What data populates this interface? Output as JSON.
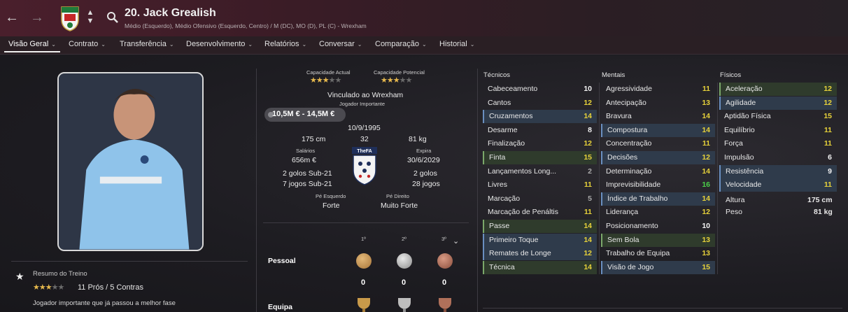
{
  "header": {
    "player_name": "20. Jack Grealish",
    "player_positions": "Médio (Esquerdo), Médio Ofensivo (Esquerdo, Centro) / M (DC), MO (D), PL (C) - Wrexham",
    "back_icon": "arrow-left-icon",
    "forward_icon": "arrow-right-icon",
    "search_icon": "search-icon"
  },
  "tabs": [
    {
      "label": "Visão Geral"
    },
    {
      "label": "Contrato"
    },
    {
      "label": "Transferência"
    },
    {
      "label": "Desenvolvimento"
    },
    {
      "label": "Relatórios"
    },
    {
      "label": "Conversar"
    },
    {
      "label": "Comparação"
    },
    {
      "label": "Historial"
    }
  ],
  "training": {
    "title": "Resumo do Treino",
    "pros_cons": "11 Prós / 5 Contras",
    "note": "Jogador importante que já passou a melhor fase",
    "stars": 3.5
  },
  "profile": {
    "current_ability_label": "Capacidade Actual",
    "potential_ability_label": "Capacidade Potencial",
    "current_ability_stars": 3.5,
    "potential_ability_stars": 3.5,
    "contract_club": "Vinculado ao Wrexham",
    "squad_status": "Jogador Importante",
    "value_range": "10,5M € - 14,5M €",
    "dob": "10/9/1995",
    "height": "175 cm",
    "age": "32",
    "weight": "81 kg",
    "wage_label": "Salários",
    "wage": "656m €",
    "expires_label": "Expira",
    "expires": "30/6/2029",
    "u21_goals": "2 golos Sub-21",
    "u21_caps": "7 jogos Sub-21",
    "intl_goals": "2 golos",
    "intl_caps": "28 jogos",
    "fa_label": "TheFA",
    "left_foot_label": "Pé Esquerdo",
    "left_foot": "Forte",
    "right_foot_label": "Pé Direito",
    "right_foot": "Muito Forte"
  },
  "awards": {
    "places": [
      "1º",
      "2º",
      "3º"
    ],
    "personal_label": "Pessoal",
    "team_label": "Equipa",
    "personal_counts": [
      "0",
      "0",
      "0"
    ]
  },
  "attributes": {
    "technical_title": "Técnicos",
    "mental_title": "Mentais",
    "physical_title": "Físicos",
    "technical": [
      {
        "name": "Cabeceamento",
        "value": "10",
        "hl": "",
        "color": "white"
      },
      {
        "name": "Cantos",
        "value": "12",
        "hl": "",
        "color": "yellow"
      },
      {
        "name": "Cruzamentos",
        "value": "14",
        "hl": "blue",
        "color": "yellow"
      },
      {
        "name": "Desarme",
        "value": "8",
        "hl": "",
        "color": "white"
      },
      {
        "name": "Finalização",
        "value": "12",
        "hl": "",
        "color": "yellow"
      },
      {
        "name": "Finta",
        "value": "15",
        "hl": "green",
        "color": "yellow"
      },
      {
        "name": "Lançamentos Long...",
        "value": "2",
        "hl": "",
        "color": "grey"
      },
      {
        "name": "Livres",
        "value": "11",
        "hl": "",
        "color": "yellow"
      },
      {
        "name": "Marcação",
        "value": "5",
        "hl": "",
        "color": "grey"
      },
      {
        "name": "Marcação de Penáltis",
        "value": "11",
        "hl": "",
        "color": "yellow"
      },
      {
        "name": "Passe",
        "value": "14",
        "hl": "green",
        "color": "yellow"
      },
      {
        "name": "Primeiro Toque",
        "value": "14",
        "hl": "blue",
        "color": "yellow"
      },
      {
        "name": "Remates de Longe",
        "value": "12",
        "hl": "blue",
        "color": "yellow"
      },
      {
        "name": "Técnica",
        "value": "14",
        "hl": "green",
        "color": "yellow"
      }
    ],
    "mental": [
      {
        "name": "Agressividade",
        "value": "11",
        "hl": "",
        "color": "yellow"
      },
      {
        "name": "Antecipação",
        "value": "13",
        "hl": "",
        "color": "yellow"
      },
      {
        "name": "Bravura",
        "value": "14",
        "hl": "",
        "color": "yellow"
      },
      {
        "name": "Compostura",
        "value": "14",
        "hl": "blue",
        "color": "yellow"
      },
      {
        "name": "Concentração",
        "value": "11",
        "hl": "",
        "color": "yellow"
      },
      {
        "name": "Decisões",
        "value": "12",
        "hl": "blue",
        "color": "yellow"
      },
      {
        "name": "Determinação",
        "value": "14",
        "hl": "",
        "color": "yellow"
      },
      {
        "name": "Imprevisibilidade",
        "value": "16",
        "hl": "",
        "color": "green"
      },
      {
        "name": "Índice de Trabalho",
        "value": "14",
        "hl": "blue",
        "color": "yellow"
      },
      {
        "name": "Liderança",
        "value": "12",
        "hl": "",
        "color": "yellow"
      },
      {
        "name": "Posicionamento",
        "value": "10",
        "hl": "",
        "color": "white"
      },
      {
        "name": "Sem Bola",
        "value": "13",
        "hl": "green",
        "color": "yellow"
      },
      {
        "name": "Trabalho de Equipa",
        "value": "13",
        "hl": "",
        "color": "yellow"
      },
      {
        "name": "Visão de Jogo",
        "value": "15",
        "hl": "blue",
        "color": "yellow"
      }
    ],
    "physical": [
      {
        "name": "Aceleração",
        "value": "12",
        "hl": "green",
        "color": "yellow"
      },
      {
        "name": "Agilidade",
        "value": "12",
        "hl": "blue",
        "color": "yellow"
      },
      {
        "name": "Aptidão Física",
        "value": "15",
        "hl": "",
        "color": "yellow"
      },
      {
        "name": "Equilíbrio",
        "value": "11",
        "hl": "",
        "color": "yellow"
      },
      {
        "name": "Força",
        "value": "11",
        "hl": "",
        "color": "yellow"
      },
      {
        "name": "Impulsão",
        "value": "6",
        "hl": "",
        "color": "white"
      },
      {
        "name": "Resistência",
        "value": "9",
        "hl": "blue",
        "color": "white"
      },
      {
        "name": "Velocidade",
        "value": "11",
        "hl": "blue",
        "color": "yellow"
      }
    ],
    "height_label": "Altura",
    "height_value": "175 cm",
    "weight_label": "Peso",
    "weight_value": "81 kg"
  },
  "colors": {
    "header_bg": "#4a1f2c",
    "stat_yellow": "#e7d23a",
    "stat_green": "#4cd14a",
    "highlight_blue": "#2f3b4b",
    "highlight_green": "#2f3b2c"
  }
}
